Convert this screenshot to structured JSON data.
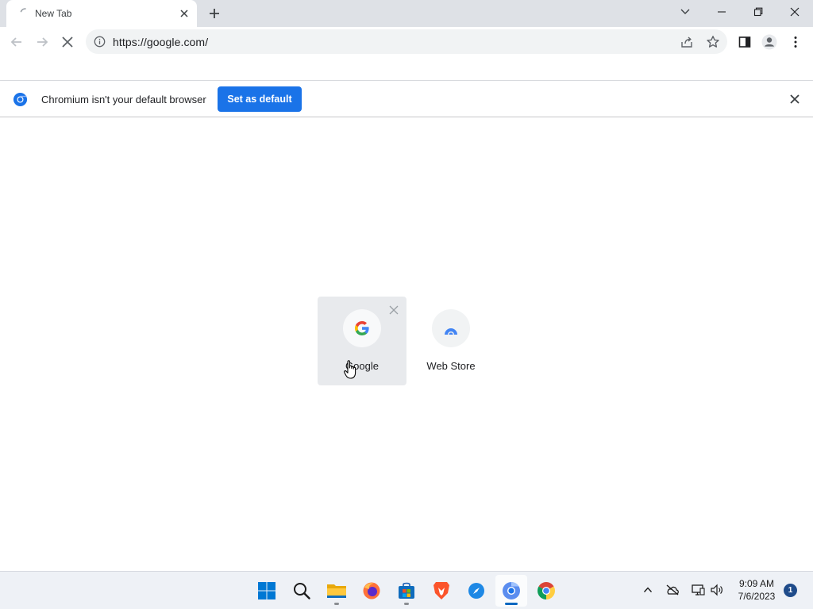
{
  "tab": {
    "title": "New Tab"
  },
  "omnibox": {
    "url": "https://google.com/"
  },
  "infobar": {
    "message": "Chromium isn't your default browser",
    "button_label": "Set as default"
  },
  "shortcuts": [
    {
      "label": "Google",
      "icon": "google-g-icon"
    },
    {
      "label": "Web Store",
      "icon": "web-store-icon"
    }
  ],
  "taskbar": {
    "apps": [
      "windows-start",
      "search",
      "file-explorer",
      "firefox",
      "microsoft-store",
      "brave",
      "safari-compass",
      "chromium",
      "chrome"
    ],
    "active_app": "chromium",
    "clock": {
      "time": "9:09 AM",
      "date": "7/6/2023"
    },
    "notification_count": "1"
  },
  "colors": {
    "accent": "#1a73e8",
    "tabstrip": "#dee1e6",
    "taskbar": "#eef1f6"
  }
}
